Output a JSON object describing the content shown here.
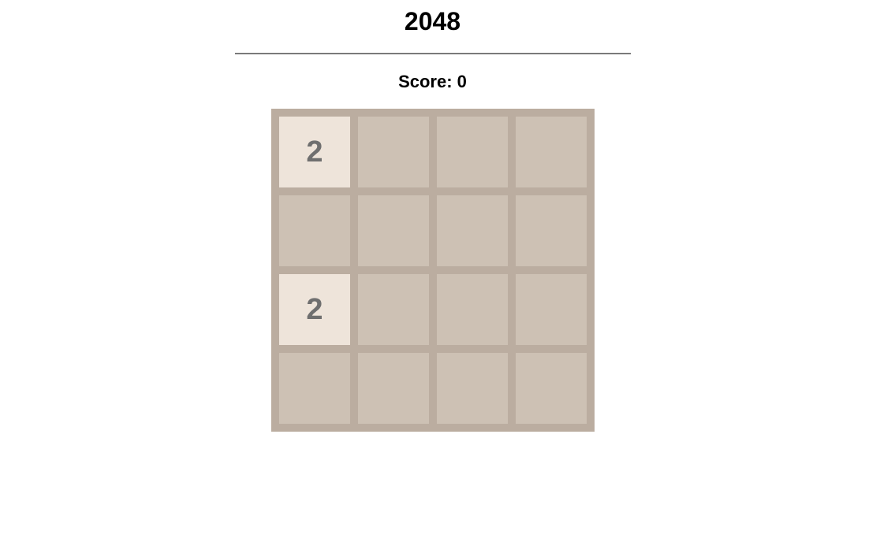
{
  "game": {
    "title": "2048",
    "score_text": "Score: 0",
    "score": 0
  },
  "board": {
    "size": 4,
    "cells": [
      [
        "2",
        "",
        "",
        ""
      ],
      [
        "",
        "",
        "",
        ""
      ],
      [
        "2",
        "",
        "",
        ""
      ],
      [
        "",
        "",
        "",
        ""
      ]
    ]
  },
  "colors": {
    "board_background": "#bbada0",
    "empty_cell": "#cdc1b4",
    "tile_2_background": "#eee4da",
    "tile_text": "#6f6f6f",
    "divider": "#7a7a7a"
  }
}
